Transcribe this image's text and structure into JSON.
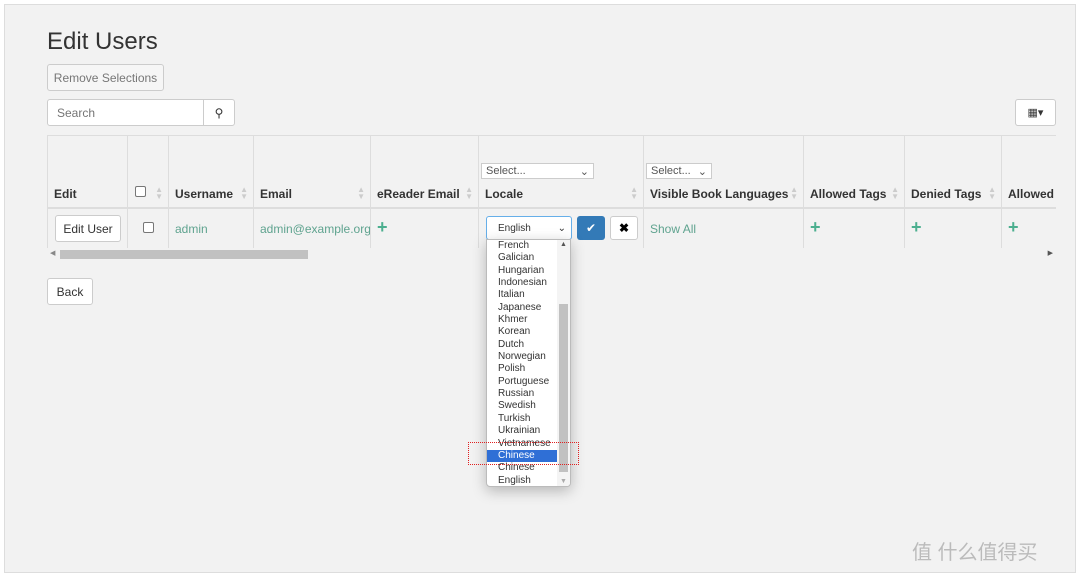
{
  "title": "Edit Users",
  "remove_selections": "Remove Selections",
  "search": {
    "placeholder": "Search"
  },
  "columns": [
    "Edit",
    "",
    "Username",
    "Email",
    "eReader Email",
    "Locale",
    "Visible Book Languages",
    "Allowed Tags",
    "Denied Tags",
    "Allowed C"
  ],
  "filters": {
    "locale": "Select...",
    "languages": "Select..."
  },
  "row": {
    "edit": "Edit User",
    "username": "admin",
    "email": "admin@example.org",
    "locale": "English",
    "languages": "Show All"
  },
  "locale_options": [
    "French",
    "Galician",
    "Hungarian",
    "Indonesian",
    "Italian",
    "Japanese",
    "Khmer",
    "Korean",
    "Dutch",
    "Norwegian",
    "Polish",
    "Portuguese",
    "Russian",
    "Swedish",
    "Turkish",
    "Ukrainian",
    "Vietnamese",
    "Chinese",
    "Chinese",
    "English"
  ],
  "highlighted_option": "Chinese",
  "back": "Back",
  "watermark": "值 什么值得买",
  "colors": {
    "accent": "#337ab7",
    "link": "#5fa38f",
    "highlight": "#2f6fd6"
  }
}
